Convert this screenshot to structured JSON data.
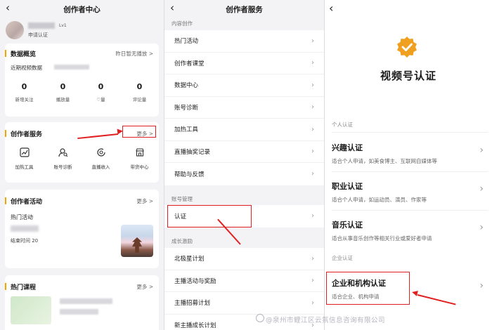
{
  "panel1": {
    "title": "创作者中心",
    "profile": {
      "lv": "Lv1",
      "apply_cert": "申请认证"
    },
    "overview": {
      "title": "数据概览",
      "more": "昨日暂无播放 >",
      "subtitle": "近期视频数据",
      "stats": [
        {
          "value": "0",
          "label": "新增关注"
        },
        {
          "value": "0",
          "label": "播放量"
        },
        {
          "value": "0",
          "label": "♡量"
        },
        {
          "value": "0",
          "label": "评论量"
        }
      ]
    },
    "services": {
      "title": "创作者服务",
      "more": "更多 >",
      "items": [
        {
          "label": "加热工具",
          "icon": "trend-chart-icon"
        },
        {
          "label": "账号诊断",
          "icon": "user-search-icon"
        },
        {
          "label": "直播收入",
          "icon": "coin-refresh-icon"
        },
        {
          "label": "带货中心",
          "icon": "shop-icon"
        }
      ]
    },
    "activity": {
      "title": "创作者活动",
      "more": "更多 >",
      "hot": "热门活动",
      "end_time": "结束时间  20"
    },
    "courses": {
      "title": "热门课程",
      "more": "更多 >"
    }
  },
  "panel2": {
    "title": "创作者服务",
    "sections": [
      {
        "label": "内容创作",
        "items": [
          "热门活动",
          "创作者课堂",
          "数据中心",
          "账号诊断",
          "加热工具",
          "直播抽奖记录",
          "帮助与反馈"
        ]
      },
      {
        "label": "账号管理",
        "items": [
          "认证"
        ]
      },
      {
        "label": "成长激励",
        "items": [
          "北极星计划",
          "主播活动与奖励",
          "主播招募计划",
          "新主播成长计划"
        ]
      }
    ]
  },
  "panel3": {
    "back": "‹",
    "title": "视频号认证",
    "personal_label": "个人认证",
    "options": [
      {
        "title": "兴趣认证",
        "desc": "适合个人申请，如美食博主、互联网自媒体等"
      },
      {
        "title": "职业认证",
        "desc": "适合个人申请，如运动员、演员、作家等"
      },
      {
        "title": "音乐认证",
        "desc": "适合从事音乐创作等相关行业或爱好者申请"
      }
    ],
    "enterprise_label": "企业认证",
    "enterprise_option": {
      "title": "企业和机构认证",
      "desc": "适合企业、机构申请"
    },
    "watermark": "@泉州市鲤江区云氛信息咨询有限公司"
  },
  "colors": {
    "accent_orange": "#f0a500",
    "highlight_red": "#e02020"
  }
}
